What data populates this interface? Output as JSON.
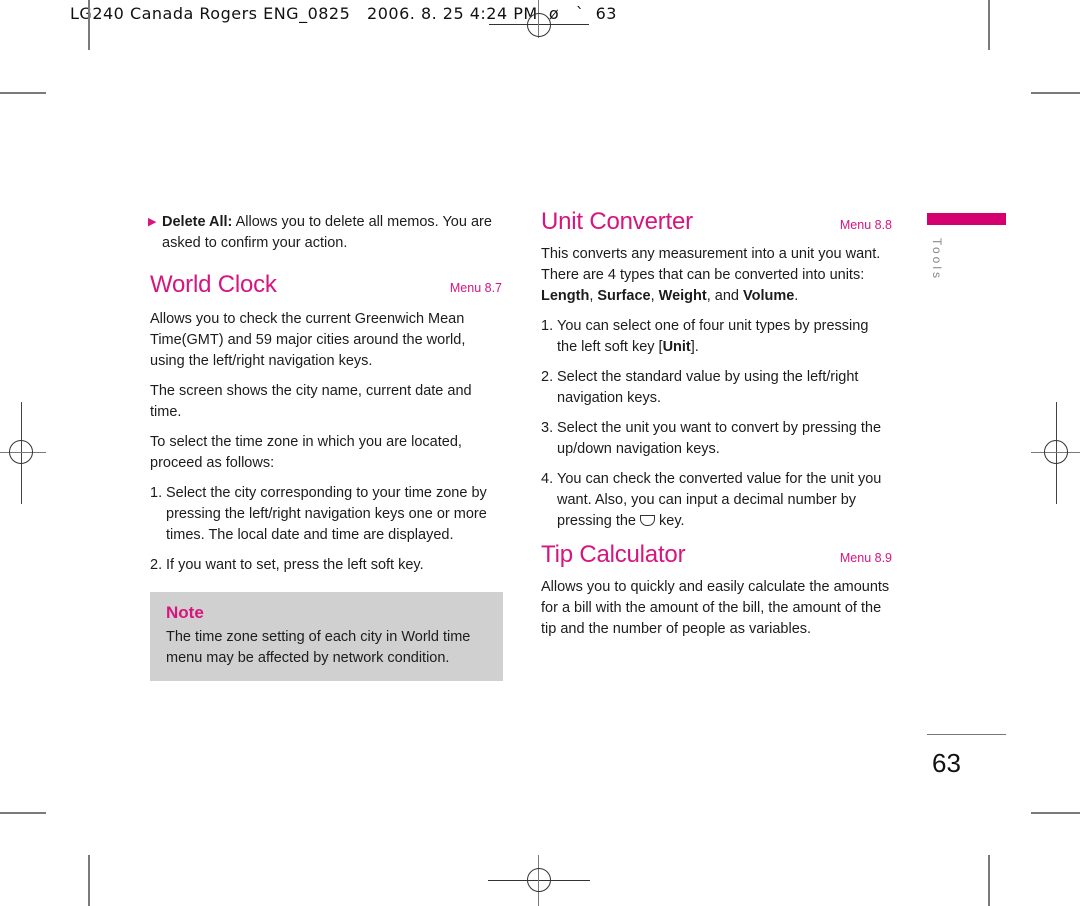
{
  "print_header": "LG240 Canada Rogers ENG_0825   2006. 8. 25 4:24 PM  ø   `  63",
  "left_column": {
    "bullet": {
      "label": "Delete All:",
      "text": " Allows you to delete all memos. You are asked to confirm your action."
    },
    "world_clock": {
      "title": "World Clock",
      "menu": "Menu 8.7",
      "paragraphs": [
        "Allows you to check the current Greenwich Mean Time(GMT) and 59 major cities around the world, using the left/right navigation keys.",
        "The screen shows the city name, current date and time.",
        "To select the time zone in which you are located, proceed as follows:"
      ],
      "steps": [
        {
          "num": "1.",
          "text": "Select the city corresponding to your time zone by pressing the left/right navigation keys one or more times. The local date and time are displayed."
        },
        {
          "num": "2.",
          "text": "If you want to set, press the left soft key."
        }
      ]
    },
    "note": {
      "title": "Note",
      "text": "The time zone setting of each city in World time menu may be affected by network condition."
    }
  },
  "right_column": {
    "unit_converter": {
      "title": "Unit Converter",
      "menu": "Menu 8.8",
      "intro": "This converts any measurement into a unit you want. There are 4 types that can be converted into units: ",
      "types": [
        "Length",
        "Surface",
        "Weight",
        "Volume"
      ],
      "types_sep1": ", ",
      "types_sep2": ", ",
      "types_sep3": ", and ",
      "types_end": ".",
      "steps": [
        {
          "num": "1.",
          "text_before": "You can select one of four unit types by pressing the left soft key [",
          "bold": "Unit",
          "text_after": "]."
        },
        {
          "num": "2.",
          "text": "Select the standard value by using the left/right navigation keys."
        },
        {
          "num": "3.",
          "text": "Select the unit you want to convert by pressing the up/down navigation keys."
        },
        {
          "num": "4.",
          "text_before": "You can check the converted value for the unit you want. Also, you can input a decimal number by pressing the",
          "icon": "soft-key-icon",
          "text_after": "key."
        }
      ]
    },
    "tip_calculator": {
      "title": "Tip Calculator",
      "menu": "Menu 8.9",
      "text": "Allows you to quickly and easily calculate the amounts for a bill with the amount of the bill, the amount of the tip and the number of people as variables."
    }
  },
  "side_tab": {
    "label": "Tools",
    "color": "#d4006f"
  },
  "page_number": "63",
  "colors": {
    "accent": "#d6157f",
    "note_bg": "#d0d0d0"
  }
}
